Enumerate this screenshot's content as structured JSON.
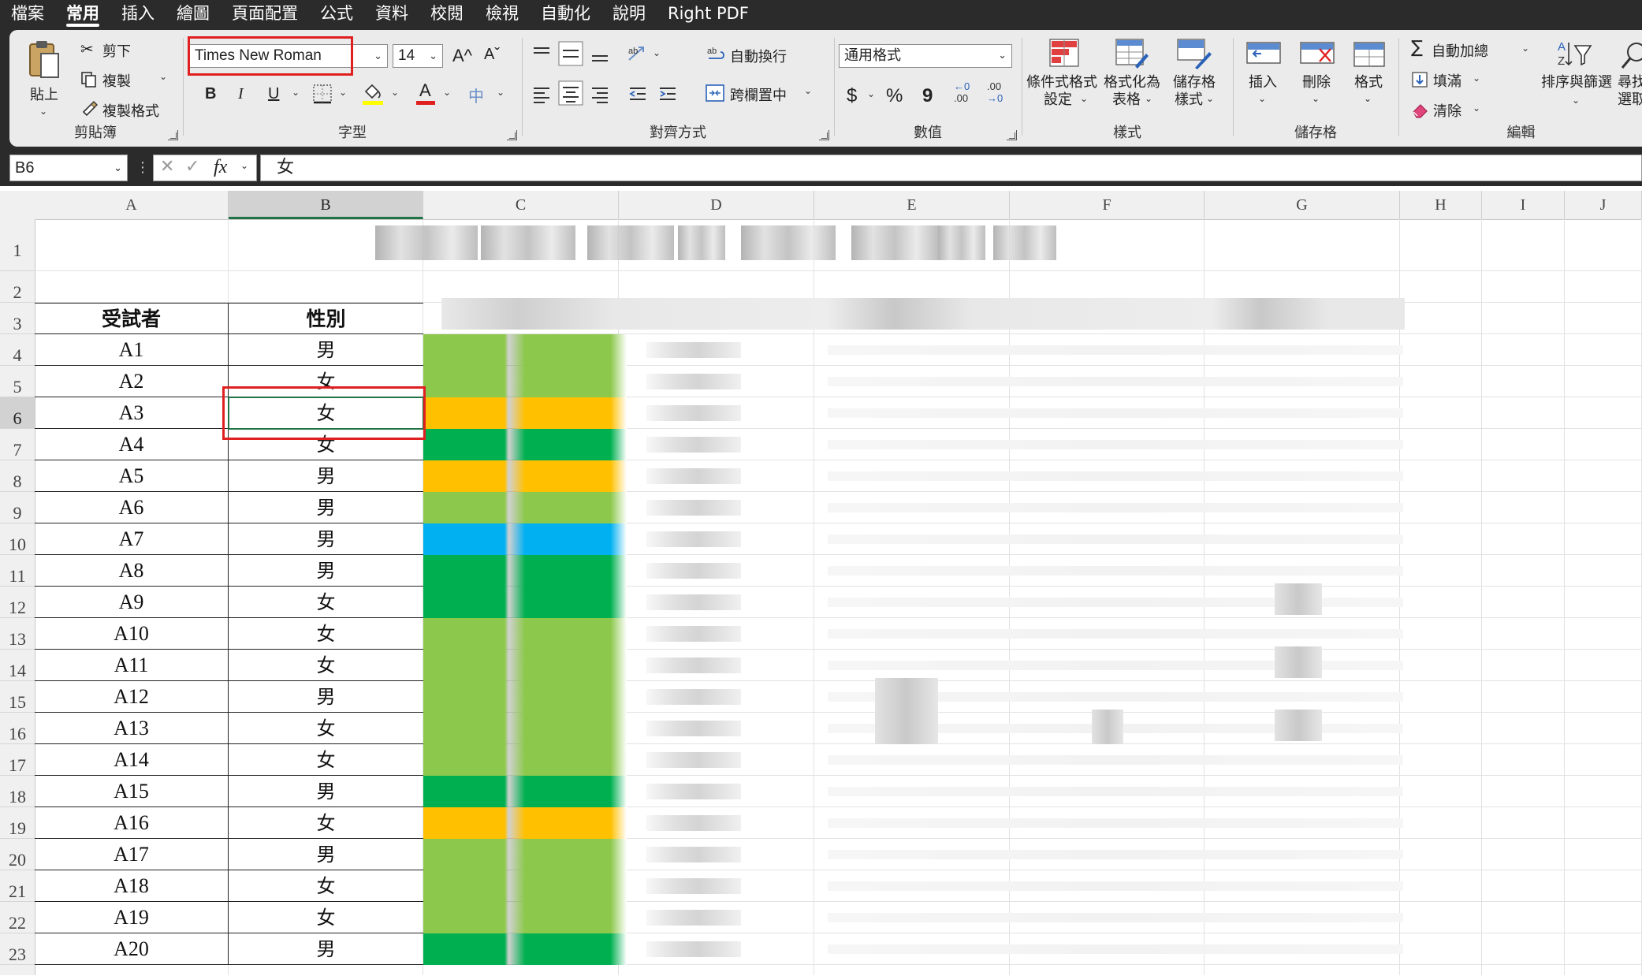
{
  "menu": {
    "tabs": [
      "檔案",
      "常用",
      "插入",
      "繪圖",
      "頁面配置",
      "公式",
      "資料",
      "校閱",
      "檢視",
      "自動化",
      "說明",
      "Right PDF"
    ],
    "active_index": 1
  },
  "ribbon": {
    "clipboard": {
      "paste": "貼上",
      "cut": "剪下",
      "copy": "複製",
      "format_painter": "複製格式",
      "group_label": "剪貼簿"
    },
    "font": {
      "font_name": "Times New Roman",
      "font_size": "14",
      "grow_icon": "A^",
      "shrink_icon": "Aˇ",
      "bold": "B",
      "italic": "I",
      "underline": "U",
      "font_color_glyph": "A",
      "phonetic_glyph": "中",
      "group_label": "字型",
      "fill_color": "#ffff00",
      "text_color": "#e02020"
    },
    "alignment": {
      "wrap_text": "自動換行",
      "merge_center": "跨欄置中",
      "group_label": "對齊方式"
    },
    "number": {
      "format": "通用格式",
      "currency": "$",
      "percent": "%",
      "comma": "9",
      "inc_decimal_top": "←0",
      "inc_decimal_bottom": ".00",
      "dec_decimal_top": ".00",
      "dec_decimal_bottom": "→0",
      "group_label": "數值"
    },
    "styles": {
      "conditional_l1": "條件式格式",
      "conditional_l2": "設定",
      "as_table_l1": "格式化為",
      "as_table_l2": "表格",
      "cell_styles_l1": "儲存格",
      "cell_styles_l2": "樣式",
      "group_label": "樣式"
    },
    "cells": {
      "insert": "插入",
      "delete": "刪除",
      "format": "格式",
      "group_label": "儲存格"
    },
    "editing": {
      "autosum": "自動加總",
      "fill": "填滿",
      "clear": "清除",
      "sort_filter": "排序與篩選",
      "find_l1": "尋找",
      "find_l2": "選取",
      "group_label": "編輯"
    }
  },
  "formula_bar": {
    "name_box": "B6",
    "fx": "fx",
    "content": "女"
  },
  "grid": {
    "columns": [
      "A",
      "B",
      "C",
      "D",
      "E",
      "F",
      "G",
      "H",
      "I",
      "J"
    ],
    "selected_column": "B",
    "selected_row": 6,
    "rows": [
      "1",
      "2",
      "3",
      "4",
      "5",
      "6",
      "7",
      "8",
      "9",
      "10",
      "11",
      "12",
      "13",
      "14",
      "15",
      "16",
      "17",
      "18",
      "19",
      "20",
      "21",
      "22",
      "23"
    ],
    "header_row": {
      "subject": "受試者",
      "gender": "性別"
    },
    "subjects": [
      "A1",
      "A2",
      "A3",
      "A4",
      "A5",
      "A6",
      "A7",
      "A8",
      "A9",
      "A10",
      "A11",
      "A12",
      "A13",
      "A14",
      "A15",
      "A16",
      "A17",
      "A18",
      "A19",
      "A20"
    ],
    "genders": [
      "男",
      "女",
      "女",
      "女",
      "男",
      "男",
      "男",
      "男",
      "女",
      "女",
      "女",
      "男",
      "女",
      "女",
      "男",
      "女",
      "男",
      "女",
      "女",
      "男"
    ],
    "column_c_colors": [
      "#8cc84b",
      "#8cc84b",
      "#ffc000",
      "#00b050",
      "#ffc000",
      "#8cc84b",
      "#00b0f0",
      "#00b050",
      "#00b050",
      "#8cc84b",
      "#8cc84b",
      "#8cc84b",
      "#8cc84b",
      "#8cc84b",
      "#00b050",
      "#ffc000",
      "#8cc84b",
      "#8cc84b",
      "#8cc84b",
      "#00b050"
    ]
  },
  "colors": {
    "accent_green": "#217346",
    "highlight_red": "#e02020",
    "dark_chrome": "#2b2b2b"
  }
}
